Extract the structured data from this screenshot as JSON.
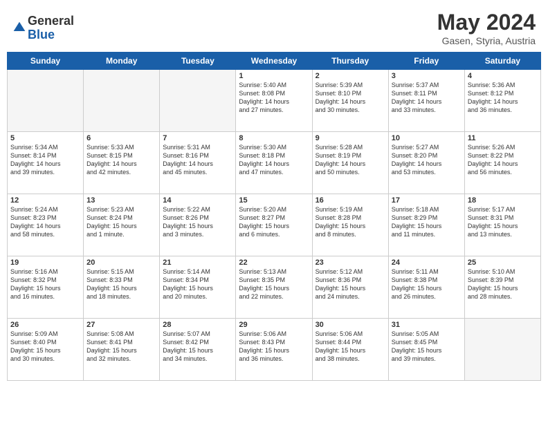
{
  "header": {
    "logo_general": "General",
    "logo_blue": "Blue",
    "title": "May 2024",
    "subtitle": "Gasen, Styria, Austria"
  },
  "days_of_week": [
    "Sunday",
    "Monday",
    "Tuesday",
    "Wednesday",
    "Thursday",
    "Friday",
    "Saturday"
  ],
  "weeks": [
    [
      {
        "day": "",
        "info": "",
        "empty": true
      },
      {
        "day": "",
        "info": "",
        "empty": true
      },
      {
        "day": "",
        "info": "",
        "empty": true
      },
      {
        "day": "1",
        "info": "Sunrise: 5:40 AM\nSunset: 8:08 PM\nDaylight: 14 hours\nand 27 minutes."
      },
      {
        "day": "2",
        "info": "Sunrise: 5:39 AM\nSunset: 8:10 PM\nDaylight: 14 hours\nand 30 minutes."
      },
      {
        "day": "3",
        "info": "Sunrise: 5:37 AM\nSunset: 8:11 PM\nDaylight: 14 hours\nand 33 minutes."
      },
      {
        "day": "4",
        "info": "Sunrise: 5:36 AM\nSunset: 8:12 PM\nDaylight: 14 hours\nand 36 minutes."
      }
    ],
    [
      {
        "day": "5",
        "info": "Sunrise: 5:34 AM\nSunset: 8:14 PM\nDaylight: 14 hours\nand 39 minutes."
      },
      {
        "day": "6",
        "info": "Sunrise: 5:33 AM\nSunset: 8:15 PM\nDaylight: 14 hours\nand 42 minutes."
      },
      {
        "day": "7",
        "info": "Sunrise: 5:31 AM\nSunset: 8:16 PM\nDaylight: 14 hours\nand 45 minutes."
      },
      {
        "day": "8",
        "info": "Sunrise: 5:30 AM\nSunset: 8:18 PM\nDaylight: 14 hours\nand 47 minutes."
      },
      {
        "day": "9",
        "info": "Sunrise: 5:28 AM\nSunset: 8:19 PM\nDaylight: 14 hours\nand 50 minutes."
      },
      {
        "day": "10",
        "info": "Sunrise: 5:27 AM\nSunset: 8:20 PM\nDaylight: 14 hours\nand 53 minutes."
      },
      {
        "day": "11",
        "info": "Sunrise: 5:26 AM\nSunset: 8:22 PM\nDaylight: 14 hours\nand 56 minutes."
      }
    ],
    [
      {
        "day": "12",
        "info": "Sunrise: 5:24 AM\nSunset: 8:23 PM\nDaylight: 14 hours\nand 58 minutes."
      },
      {
        "day": "13",
        "info": "Sunrise: 5:23 AM\nSunset: 8:24 PM\nDaylight: 15 hours\nand 1 minute."
      },
      {
        "day": "14",
        "info": "Sunrise: 5:22 AM\nSunset: 8:26 PM\nDaylight: 15 hours\nand 3 minutes."
      },
      {
        "day": "15",
        "info": "Sunrise: 5:20 AM\nSunset: 8:27 PM\nDaylight: 15 hours\nand 6 minutes."
      },
      {
        "day": "16",
        "info": "Sunrise: 5:19 AM\nSunset: 8:28 PM\nDaylight: 15 hours\nand 8 minutes."
      },
      {
        "day": "17",
        "info": "Sunrise: 5:18 AM\nSunset: 8:29 PM\nDaylight: 15 hours\nand 11 minutes."
      },
      {
        "day": "18",
        "info": "Sunrise: 5:17 AM\nSunset: 8:31 PM\nDaylight: 15 hours\nand 13 minutes."
      }
    ],
    [
      {
        "day": "19",
        "info": "Sunrise: 5:16 AM\nSunset: 8:32 PM\nDaylight: 15 hours\nand 16 minutes."
      },
      {
        "day": "20",
        "info": "Sunrise: 5:15 AM\nSunset: 8:33 PM\nDaylight: 15 hours\nand 18 minutes."
      },
      {
        "day": "21",
        "info": "Sunrise: 5:14 AM\nSunset: 8:34 PM\nDaylight: 15 hours\nand 20 minutes."
      },
      {
        "day": "22",
        "info": "Sunrise: 5:13 AM\nSunset: 8:35 PM\nDaylight: 15 hours\nand 22 minutes."
      },
      {
        "day": "23",
        "info": "Sunrise: 5:12 AM\nSunset: 8:36 PM\nDaylight: 15 hours\nand 24 minutes."
      },
      {
        "day": "24",
        "info": "Sunrise: 5:11 AM\nSunset: 8:38 PM\nDaylight: 15 hours\nand 26 minutes."
      },
      {
        "day": "25",
        "info": "Sunrise: 5:10 AM\nSunset: 8:39 PM\nDaylight: 15 hours\nand 28 minutes."
      }
    ],
    [
      {
        "day": "26",
        "info": "Sunrise: 5:09 AM\nSunset: 8:40 PM\nDaylight: 15 hours\nand 30 minutes."
      },
      {
        "day": "27",
        "info": "Sunrise: 5:08 AM\nSunset: 8:41 PM\nDaylight: 15 hours\nand 32 minutes."
      },
      {
        "day": "28",
        "info": "Sunrise: 5:07 AM\nSunset: 8:42 PM\nDaylight: 15 hours\nand 34 minutes."
      },
      {
        "day": "29",
        "info": "Sunrise: 5:06 AM\nSunset: 8:43 PM\nDaylight: 15 hours\nand 36 minutes."
      },
      {
        "day": "30",
        "info": "Sunrise: 5:06 AM\nSunset: 8:44 PM\nDaylight: 15 hours\nand 38 minutes."
      },
      {
        "day": "31",
        "info": "Sunrise: 5:05 AM\nSunset: 8:45 PM\nDaylight: 15 hours\nand 39 minutes."
      },
      {
        "day": "",
        "info": "",
        "empty": true
      }
    ]
  ]
}
